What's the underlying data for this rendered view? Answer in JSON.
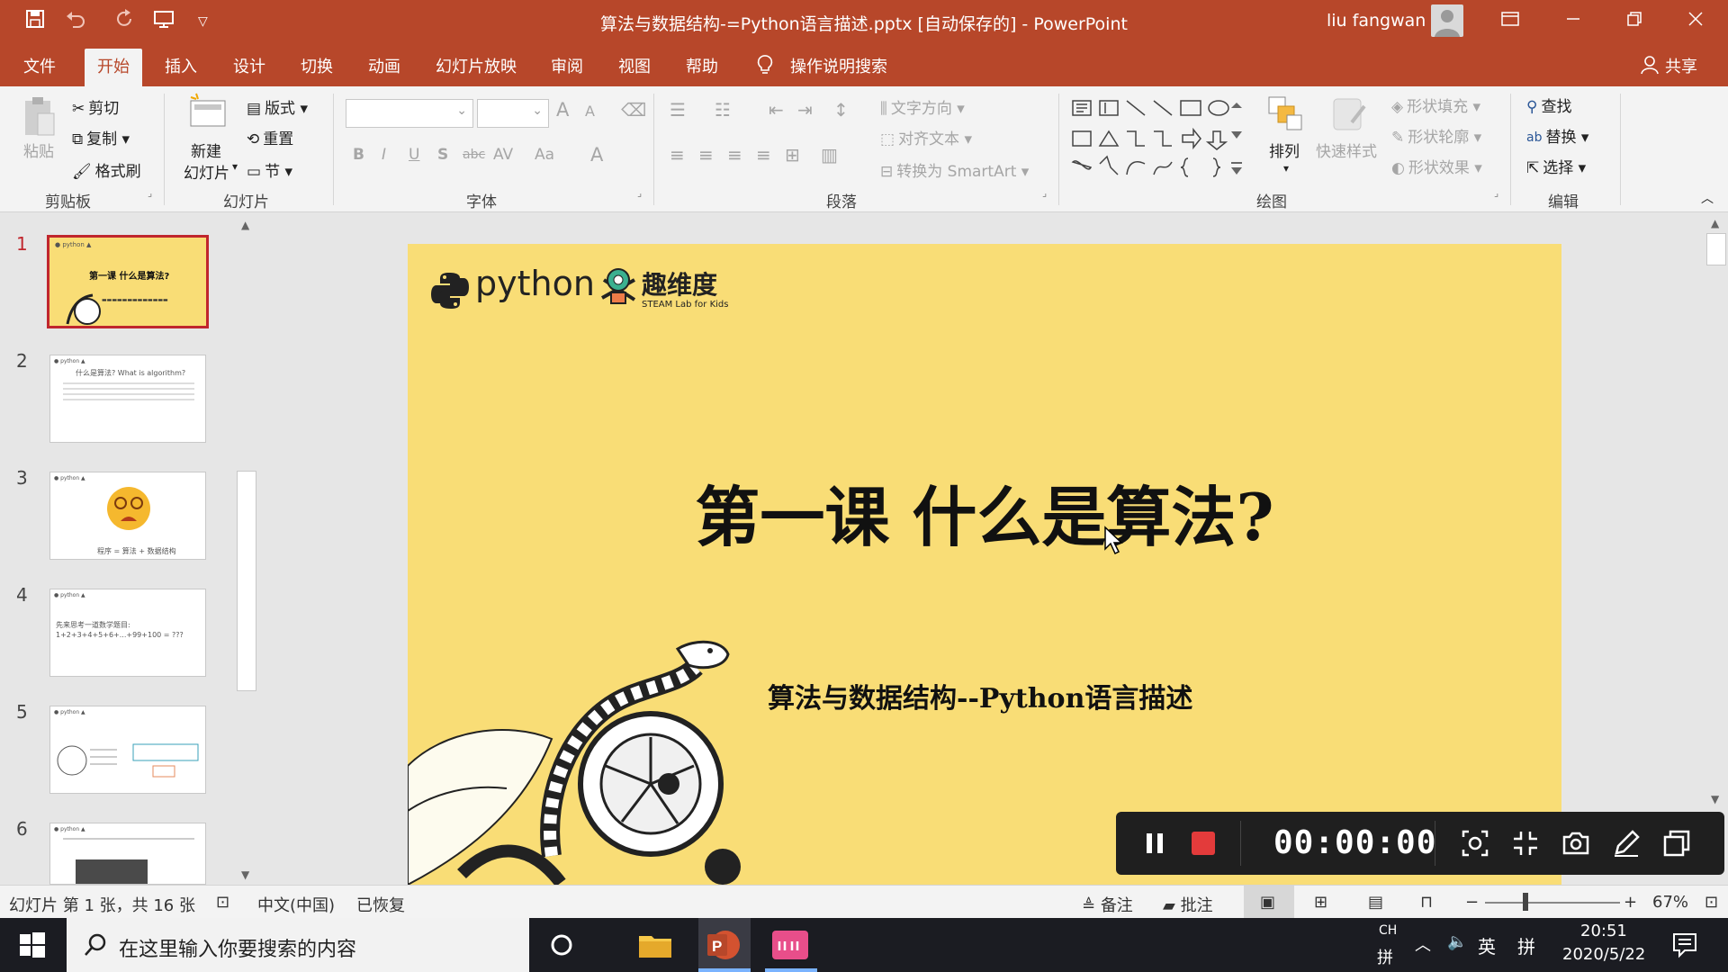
{
  "titlebar": {
    "doc_title": "算法与数据结构-=Python语言描述.pptx [自动保存的] - PowerPoint",
    "user_name": "liu fangwan"
  },
  "menu": {
    "tabs": [
      "文件",
      "开始",
      "插入",
      "设计",
      "切换",
      "动画",
      "幻灯片放映",
      "审阅",
      "视图",
      "帮助"
    ],
    "tell_me": "操作说明搜索",
    "share": "共享"
  },
  "ribbon": {
    "clipboard": {
      "paste": "粘贴",
      "cut": "剪切",
      "copy": "复制",
      "format_painter": "格式刷",
      "label": "剪贴板"
    },
    "slides": {
      "new_slide_1": "新建",
      "new_slide_2": "幻灯片",
      "layout": "版式",
      "reset": "重置",
      "section": "节",
      "label": "幻灯片"
    },
    "font": {
      "label": "字体",
      "bold": "B",
      "italic": "I",
      "underline": "U",
      "shadow": "S",
      "strike": "abc",
      "spacing": "AV",
      "case": "Aa",
      "color": "A",
      "grow": "A",
      "shrink": "A"
    },
    "paragraph": {
      "label": "段落",
      "text_direction": "文字方向",
      "align_text": "对齐文本",
      "smartart": "转换为 SmartArt"
    },
    "drawing": {
      "label": "绘图",
      "arrange": "排列",
      "quick_styles": "快速样式",
      "shape_fill": "形状填充",
      "shape_outline": "形状轮廓",
      "shape_effects": "形状效果"
    },
    "editing": {
      "label": "编辑",
      "find": "查找",
      "replace": "替换",
      "select": "选择"
    }
  },
  "thumbnails": [
    {
      "num": "1",
      "text": "第一课 什么是算法?",
      "selected": true
    },
    {
      "num": "2",
      "text": "什么是算法? What is algorithm?"
    },
    {
      "num": "3",
      "text": "程序 = 算法 + 数据结构"
    },
    {
      "num": "4",
      "text": "先来思考一道数学题目: 1+2+3+4+5+6+...+99+100 = ???"
    },
    {
      "num": "5",
      "text": ""
    },
    {
      "num": "6",
      "text": ""
    }
  ],
  "slide": {
    "logo_text": "python",
    "brand_text": "趣维度",
    "brand_sub": "STEAM Lab for Kids",
    "title": "第一课 什么是算法?",
    "subtitle": "算法与数据结构--Python语言描述"
  },
  "recorder": {
    "time": "00:00:00"
  },
  "status": {
    "slide_info": "幻灯片 第 1 张，共 16 张",
    "language": "中文(中国)",
    "recovered": "已恢复",
    "notes": "备注",
    "comments": "批注",
    "zoom": "67%"
  },
  "taskbar": {
    "search_placeholder": "在这里输入你要搜索的内容",
    "ime1": "CH",
    "ime2": "拼",
    "lang": "英",
    "ime3": "拼",
    "time": "20:51",
    "date": "2020/5/22"
  },
  "colors": {
    "accent": "#b7472a",
    "slide_bg": "#f9dd76",
    "selected_border": "#c0262d"
  }
}
